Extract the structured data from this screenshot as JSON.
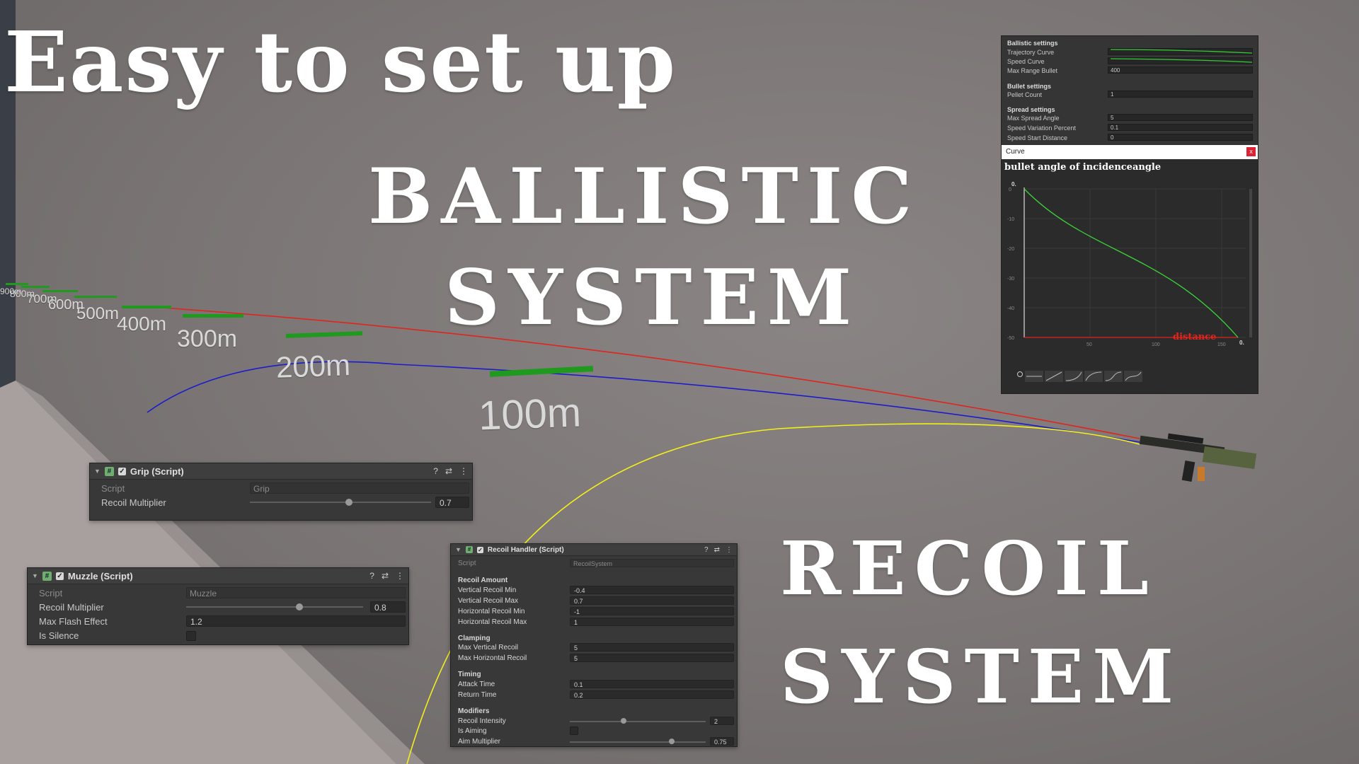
{
  "headlines": {
    "easy": "Easy to set up",
    "ballistic_1": "BALLISTIC",
    "ballistic_2": "SYSTEM",
    "recoil_1": "RECOIL",
    "recoil_2": "SYSTEM"
  },
  "distance_labels": [
    "100m",
    "200m",
    "300m",
    "400m",
    "500m",
    "600m",
    "700m",
    "800m",
    "900m"
  ],
  "trajectory_colors": {
    "red": "#e0241e",
    "blue": "#1c1ccc",
    "yellow": "#f4ee1a",
    "marker": "#1f9a1f"
  },
  "ballistic_settings": {
    "section_ballistic": "Ballistic settings",
    "trajectory_curve_label": "Trajectory Curve",
    "speed_curve_label": "Speed Curve",
    "max_range_label": "Max Range Bullet",
    "max_range_value": "400",
    "section_bullet": "Bullet settings",
    "pellet_count_label": "Pellet Count",
    "pellet_count_value": "1",
    "section_spread": "Spread settings",
    "max_spread_label": "Max Spread Angle",
    "max_spread_value": "5",
    "speed_variation_label": "Speed Variation Percent",
    "speed_variation_value": "0.1",
    "spread_start_label": "Speed Start Distance",
    "spread_start_value": "0"
  },
  "curve_window": {
    "title": "Curve",
    "close": "x",
    "heading": "bullet angle of incidenceangle",
    "xlabel": "distance",
    "y_ticks": [
      "0",
      "-10",
      "-20",
      "-30",
      "-40",
      "-50"
    ],
    "x_ticks": [
      "50",
      "100",
      "150"
    ],
    "corner_labels": [
      "0.",
      "0."
    ]
  },
  "grip": {
    "title": "Grip (Script)",
    "script_label": "Script",
    "script_value": "Grip",
    "recoil_label": "Recoil Multiplier",
    "recoil_value": "0.7",
    "recoil_level": 0.7
  },
  "muzzle": {
    "title": "Muzzle (Script)",
    "script_label": "Script",
    "script_value": "Muzzle",
    "recoil_label": "Recoil Multiplier",
    "recoil_value": "0.8",
    "recoil_level": 0.8,
    "flash_label": "Max Flash Effect",
    "flash_value": "1.2",
    "silence_label": "Is Silence"
  },
  "recoil_handler": {
    "title": "Recoil Handler (Script)",
    "script_label": "Script",
    "script_value": "RecoilSystem",
    "section_amount": "Recoil Amount",
    "vmin_label": "Vertical Recoil Min",
    "vmin_value": "-0.4",
    "vmax_label": "Vertical Recoil Max",
    "vmax_value": "0.7",
    "hmin_label": "Horizontal Recoil Min",
    "hmin_value": "-1",
    "hmax_label": "Horizontal Recoil Max",
    "hmax_value": "1",
    "section_clamping": "Clamping",
    "maxv_label": "Max Vertical Recoil",
    "maxv_value": "5",
    "maxh_label": "Max Horizontal Recoil",
    "maxh_value": "5",
    "section_timing": "Timing",
    "attack_label": "Attack Time",
    "attack_value": "0.1",
    "return_label": "Return Time",
    "return_value": "0.2",
    "section_modifiers": "Modifiers",
    "intensity_label": "Recoil Intensity",
    "intensity_value": "2",
    "aiming_label": "Is Aiming",
    "aim_label": "Aim Multiplier",
    "aim_value": "0.75"
  }
}
